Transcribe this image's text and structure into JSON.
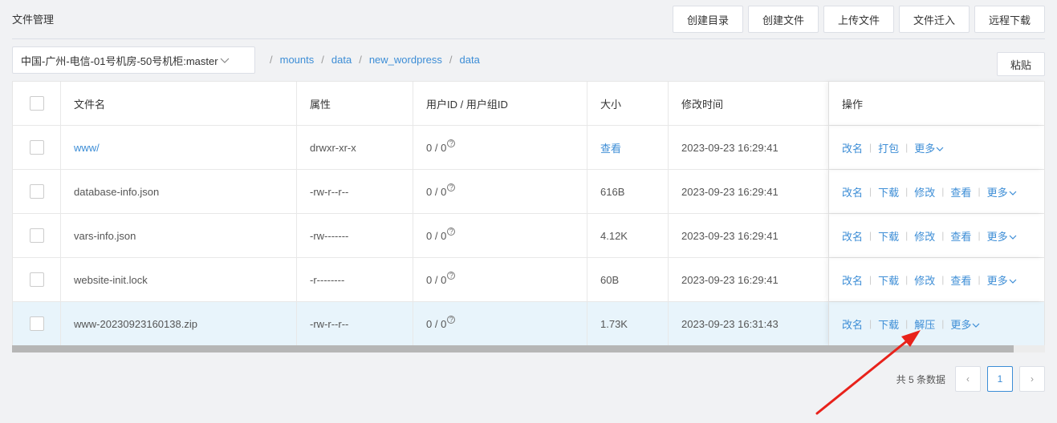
{
  "page_title": "文件管理",
  "toolbar": {
    "create_dir": "创建目录",
    "create_file": "创建文件",
    "upload_file": "上传文件",
    "migrate_file": "文件迁入",
    "remote_download": "远程下载"
  },
  "server_select": {
    "value": "中国-广州-电信-01号机房-50号机柜:master"
  },
  "breadcrumb": [
    "mounts",
    "data",
    "new_wordpress",
    "data"
  ],
  "paste_label": "粘贴",
  "table": {
    "headers": {
      "name": "文件名",
      "attr": "属性",
      "uid": "用户ID / 用户组ID",
      "size": "大小",
      "mtime": "修改时间",
      "ops": "操作"
    },
    "rows": [
      {
        "name": "www/",
        "attr": "drwxr-xr-x",
        "uid": "0 / 0",
        "size": "查看",
        "mtime": "2023-09-23 16:29:41",
        "ops": [
          "改名",
          "打包",
          "更多"
        ]
      },
      {
        "name": "database-info.json",
        "attr": "-rw-r--r--",
        "uid": "0 / 0",
        "size": "616B",
        "mtime": "2023-09-23 16:29:41",
        "ops": [
          "改名",
          "下载",
          "修改",
          "查看",
          "更多"
        ]
      },
      {
        "name": "vars-info.json",
        "attr": "-rw-------",
        "uid": "0 / 0",
        "size": "4.12K",
        "mtime": "2023-09-23 16:29:41",
        "ops": [
          "改名",
          "下载",
          "修改",
          "查看",
          "更多"
        ]
      },
      {
        "name": "website-init.lock",
        "attr": "-r--------",
        "uid": "0 / 0",
        "size": "60B",
        "mtime": "2023-09-23 16:29:41",
        "ops": [
          "改名",
          "下载",
          "修改",
          "查看",
          "更多"
        ]
      },
      {
        "name": "www-20230923160138.zip",
        "attr": "-rw-r--r--",
        "uid": "0 / 0",
        "size": "1.73K",
        "mtime": "2023-09-23 16:31:43",
        "ops": [
          "改名",
          "下载",
          "解压",
          "更多"
        ]
      }
    ]
  },
  "pagination": {
    "total_text": "共 5 条数据",
    "current_page": "1",
    "prev": "‹",
    "next": "›"
  },
  "colors": {
    "link": "#3c8dd6",
    "highlight_row": "#e8f4fb",
    "annotation_arrow": "#e8221b"
  }
}
